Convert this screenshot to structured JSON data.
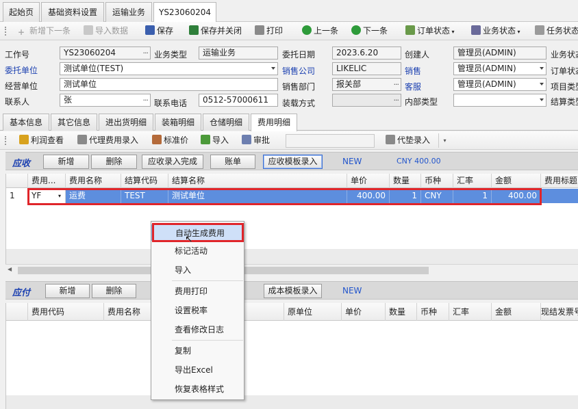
{
  "tabs": [
    "起始页",
    "基础资料设置",
    "运输业务",
    "YS23060204"
  ],
  "toolbar": {
    "add_next": "新增下一条",
    "import_data": "导入数据",
    "save": "保存",
    "save_close": "保存并关闭",
    "print": "打印",
    "prev": "上一条",
    "next": "下一条",
    "order_status": "订单状态",
    "biz_status": "业务状态",
    "task_status": "任务状态"
  },
  "form": {
    "job_no_label": "工作号",
    "job_no": "YS23060204",
    "biz_type_label": "业务类型",
    "biz_type": "运输业务",
    "entrust_date_label": "委托日期",
    "entrust_date": "2023.6.20",
    "creator_label": "创建人",
    "creator": "管理员(ADMIN)",
    "biz_status_label": "业务状态",
    "client_label": "委托单位",
    "client": "测试单位(TEST)",
    "sales_company_label": "销售公司",
    "sales_company": "LIKELIC",
    "sales_label": "销售",
    "sales": "管理员(ADMIN)",
    "order_status_label": "订单状态",
    "operator_label": "经营单位",
    "operator": "测试单位",
    "sales_dept_label": "销售部门",
    "sales_dept": "报关部",
    "cs_label": "客服",
    "cs": "管理员(ADMIN)",
    "project_type_label": "项目类型",
    "contact_label": "联系人",
    "contact": "张",
    "phone_label": "联系电话",
    "phone": "0512-57000611",
    "load_method_label": "装载方式",
    "load_method": "",
    "internal_type_label": "内部类型",
    "internal_type": "",
    "settle_type_label": "结算类型"
  },
  "subtabs": [
    "基本信息",
    "其它信息",
    "进出货明细",
    "装箱明细",
    "仓储明细",
    "费用明细"
  ],
  "toolbar2": {
    "profit": "利润查看",
    "agent_fee": "代理费用录入",
    "std_price": "标准价",
    "import": "导入",
    "approve": "审批",
    "advance": "代垫录入"
  },
  "receivable": {
    "title": "应收",
    "buttons": [
      "新增",
      "删除",
      "应收录入完成",
      "账单",
      "应收模板录入"
    ],
    "status": "NEW",
    "total": "CNY 400.00",
    "columns": [
      "费用...",
      "费用名称",
      "结算代码",
      "结算名称",
      "单价",
      "数量",
      "币种",
      "汇率",
      "金额",
      "费用标题"
    ],
    "rows": [
      {
        "idx": "1",
        "code": "YF",
        "name": "运费",
        "settle_code": "TEST",
        "settle_name": "测试单位",
        "price": "400.00",
        "qty": "1",
        "currency": "CNY",
        "rate": "1",
        "amount": "400.00"
      }
    ]
  },
  "payable": {
    "title": "应付",
    "buttons": [
      "新增",
      "删除",
      "成本模板录入"
    ],
    "status": "NEW",
    "columns": [
      "费用代码",
      "费用名称",
      "原单位",
      "单价",
      "数量",
      "币种",
      "汇率",
      "金额",
      "现结发票号"
    ]
  },
  "context_menu": [
    "自动生成费用",
    "标记活动",
    "导入",
    "费用打印",
    "设置税率",
    "查看修改日志",
    "复制",
    "导出Excel",
    "恢复表格样式"
  ],
  "colors": {
    "selected_row": "#5d8ede",
    "highlight_box": "#e0252a",
    "accent_blue": "#1a3fb0"
  }
}
